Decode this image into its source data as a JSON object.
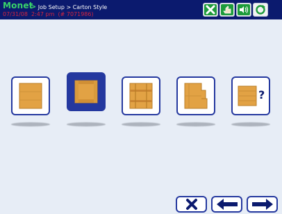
{
  "header": {
    "brand": "Monet",
    "breadcrumb_sep": ">",
    "breadcrumb": "Job Setup > Carton Style",
    "datetime": "07/31/08  2:47 pm  (# 7071986)"
  },
  "header_buttons": [
    {
      "name": "cancel-header-button",
      "icon": "x-icon"
    },
    {
      "name": "confirm-header-button",
      "icon": "hand-check-icon"
    },
    {
      "name": "sound-button",
      "icon": "speaker-icon"
    },
    {
      "name": "refresh-button",
      "icon": "refresh-icon"
    }
  ],
  "carton_styles": [
    {
      "name": "carton-style-1",
      "icon": "flat-carton-icon",
      "selected": false
    },
    {
      "name": "carton-style-2",
      "icon": "framed-carton-icon",
      "selected": true
    },
    {
      "name": "carton-style-3",
      "icon": "banded-carton-icon",
      "selected": false
    },
    {
      "name": "carton-style-4",
      "icon": "notched-carton-icon",
      "selected": false
    },
    {
      "name": "carton-style-5",
      "icon": "unknown-carton-icon",
      "selected": false,
      "label": "?"
    }
  ],
  "nav_buttons": [
    {
      "name": "cancel-button",
      "icon": "x-icon"
    },
    {
      "name": "back-button",
      "icon": "arrow-left-icon"
    },
    {
      "name": "next-button",
      "icon": "arrow-right-icon"
    }
  ],
  "colors": {
    "header_bg": "#0b1a6e",
    "brand": "#39d36b",
    "datetime": "#d7263d",
    "accent": "#24389f",
    "carton": "#e2a244"
  }
}
